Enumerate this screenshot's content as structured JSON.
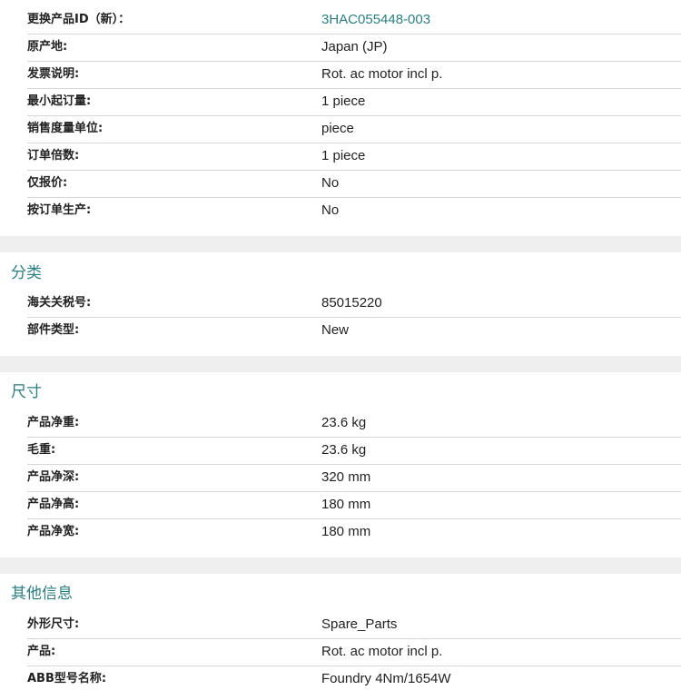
{
  "sections": [
    {
      "title": "",
      "rows": [
        {
          "label": "更换产品ID（新）：",
          "value": "3HAC055448-003",
          "link": true
        },
        {
          "label": "原产地:",
          "value": "Japan (JP)"
        },
        {
          "label": "发票说明:",
          "value": "Rot. ac motor incl p."
        },
        {
          "label": "最小起订量:",
          "value": "1 piece"
        },
        {
          "label": "销售度量单位:",
          "value": "piece"
        },
        {
          "label": "订单倍数:",
          "value": "1 piece"
        },
        {
          "label": "仅报价:",
          "value": "No"
        },
        {
          "label": "按订单生产:",
          "value": "No"
        }
      ]
    },
    {
      "title": "分类",
      "rows": [
        {
          "label": "海关关税号:",
          "value": "85015220"
        },
        {
          "label": "部件类型:",
          "value": "New"
        }
      ]
    },
    {
      "title": "尺寸",
      "rows": [
        {
          "label": "产品净重:",
          "value": "23.6 kg"
        },
        {
          "label": "毛重:",
          "value": "23.6 kg"
        },
        {
          "label": "产品净深:",
          "value": "320 mm"
        },
        {
          "label": "产品净高:",
          "value": "180 mm"
        },
        {
          "label": "产品净宽:",
          "value": "180 mm"
        }
      ]
    },
    {
      "title": "其他信息",
      "rows": [
        {
          "label": "外形尺寸:",
          "value": "Spare_Parts"
        },
        {
          "label": "产品:",
          "value": "Rot. ac motor incl p."
        },
        {
          "label": "ABB型号名称:",
          "value": "Foundry 4Nm/1654W"
        }
      ]
    }
  ],
  "colors": {
    "accent": "#2a7f83",
    "text": "#222222",
    "divider": "#d6d6d6",
    "background": "#efefef",
    "card": "#ffffff"
  }
}
